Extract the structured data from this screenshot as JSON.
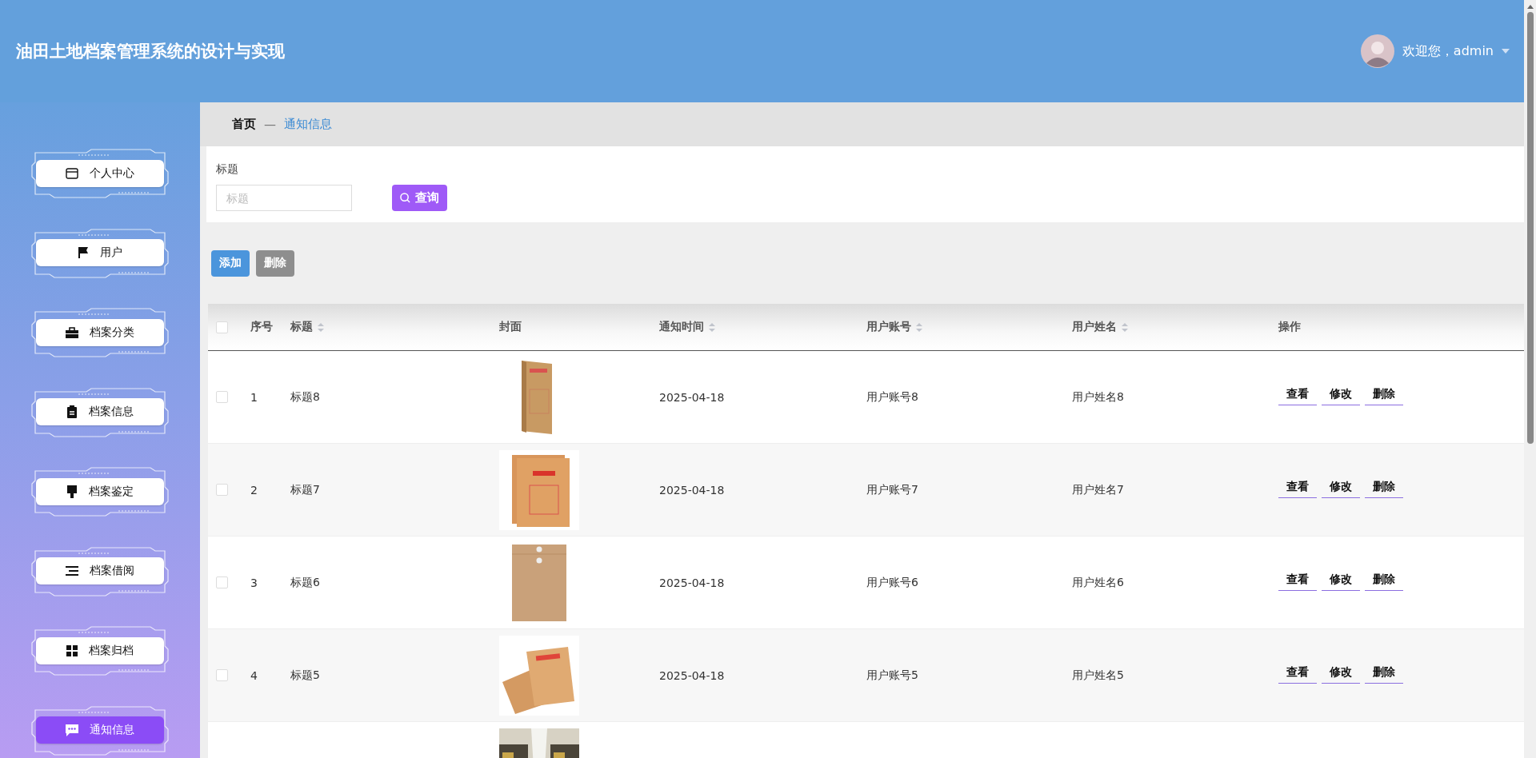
{
  "header": {
    "title": "油田土地档案管理系统的设计与实现",
    "greeting": "欢迎您，admin"
  },
  "sidebar": {
    "items": [
      {
        "label": "个人中心",
        "selected": false
      },
      {
        "label": "用户",
        "selected": false
      },
      {
        "label": "档案分类",
        "selected": false
      },
      {
        "label": "档案信息",
        "selected": false
      },
      {
        "label": "档案鉴定",
        "selected": false
      },
      {
        "label": "档案借阅",
        "selected": false
      },
      {
        "label": "档案归档",
        "selected": false
      },
      {
        "label": "通知信息",
        "selected": true
      }
    ]
  },
  "breadcrumb": {
    "home": "首页",
    "separator": "—",
    "current": "通知信息"
  },
  "search": {
    "label": "标题",
    "placeholder": "标题",
    "button": "查询"
  },
  "actions": {
    "add": "添加",
    "delete": "删除"
  },
  "table": {
    "select_all": {
      "checked": false
    },
    "columns": [
      {
        "label": "序号",
        "sortable": false
      },
      {
        "label": "标题",
        "sortable": true
      },
      {
        "label": "封面",
        "sortable": false
      },
      {
        "label": "通知时间",
        "sortable": true
      },
      {
        "label": "用户账号",
        "sortable": true
      },
      {
        "label": "用户姓名",
        "sortable": true
      },
      {
        "label": "操作",
        "sortable": false
      }
    ],
    "rows": [
      {
        "kind": "record",
        "checked": false,
        "index": "1",
        "title": "标题8",
        "date": "2025-04-18",
        "account": "用户账号8",
        "name": "用户姓名8",
        "actions": [
          "查看",
          "修改",
          "删除"
        ]
      },
      {
        "kind": "record",
        "checked": false,
        "index": "2",
        "title": "标题7",
        "date": "2025-04-18",
        "account": "用户账号7",
        "name": "用户姓名7",
        "actions": [
          "查看",
          "修改",
          "删除"
        ]
      },
      {
        "kind": "record",
        "checked": false,
        "index": "3",
        "title": "标题6",
        "date": "2025-04-18",
        "account": "用户账号6",
        "name": "用户姓名6",
        "actions": [
          "查看",
          "修改",
          "删除"
        ]
      },
      {
        "kind": "record",
        "checked": false,
        "index": "4",
        "title": "标题5",
        "date": "2025-04-18",
        "account": "用户账号5",
        "name": "用户姓名5",
        "actions": [
          "查看",
          "修改",
          "删除"
        ]
      },
      {
        "kind": "partial"
      }
    ]
  }
}
